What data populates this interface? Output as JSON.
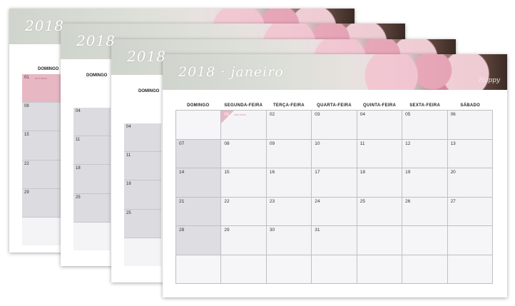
{
  "front": {
    "title": "2018 · janeiro",
    "brand": "Happy",
    "day_headers": [
      "DOMINGO",
      "SEGUNDA-FEIRA",
      "TERÇA-FEIRA",
      "QUARTA-FEIRA",
      "QUINTA-FEIRA",
      "SEXTA-FEIRA",
      "SÁBADO"
    ],
    "weeks": [
      [
        "",
        "01",
        "02",
        "03",
        "04",
        "05",
        "06"
      ],
      [
        "07",
        "08",
        "09",
        "10",
        "11",
        "12",
        "13"
      ],
      [
        "14",
        "15",
        "16",
        "17",
        "18",
        "19",
        "20"
      ],
      [
        "21",
        "22",
        "23",
        "24",
        "25",
        "26",
        "27"
      ],
      [
        "28",
        "29",
        "30",
        "31",
        "",
        "",
        ""
      ],
      [
        "",
        "",
        "",
        "",
        "",
        "",
        ""
      ]
    ],
    "holiday_note": "ano novo"
  },
  "back1": {
    "title": "2018",
    "label": "DOMINGO",
    "dates": [
      "01",
      "08",
      "15",
      "22",
      "29"
    ],
    "note": "ano novo"
  },
  "back2": {
    "title": "2018",
    "label": "DOMINGO",
    "dates": [
      "04",
      "11",
      "18",
      "25"
    ]
  },
  "back3": {
    "title": "2018",
    "label": "DOMINGO",
    "dates": [
      "04",
      "11",
      "18",
      "25"
    ]
  },
  "colors": {
    "accent": "#e8b7c4",
    "weekend": "#dedee2",
    "weekday": "#f4f4f6"
  }
}
